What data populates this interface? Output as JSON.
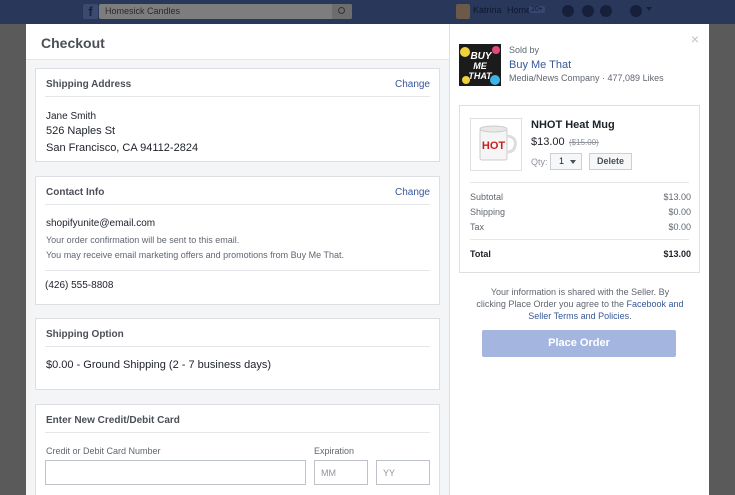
{
  "topbar": {
    "search_value": "Homesick Candles",
    "user_name": "Katrina",
    "home_label": "Home",
    "home_count": "20+"
  },
  "checkout": {
    "title": "Checkout",
    "shipping_address": {
      "title": "Shipping Address",
      "change_label": "Change",
      "name": "Jane Smith",
      "street": "526 Naples St",
      "city_line": "San Francisco, CA 94112-2824"
    },
    "contact_info": {
      "title": "Contact Info",
      "change_label": "Change",
      "email": "shopifyunite@email.com",
      "note_line1": "Your order confirmation will be sent to this email.",
      "note_line2": "You may receive email marketing offers and promotions from Buy Me That.",
      "phone": "(426) 555-8808"
    },
    "shipping_option": {
      "title": "Shipping Option",
      "value": "$0.00 - Ground Shipping (2 - 7 business days)"
    },
    "card": {
      "title": "Enter New Credit/Debit Card",
      "number_label": "Credit or Debit Card Number",
      "expiration_label": "Expiration",
      "mm_placeholder": "MM",
      "yy_placeholder": "YY"
    }
  },
  "seller": {
    "sold_by_label": "Sold by",
    "name": "Buy Me That",
    "meta": "Media/News Company · 477,089 Likes",
    "logo_text_1": "BUY",
    "logo_text_2": "ME",
    "logo_text_3": "THAT"
  },
  "order": {
    "product_name": "NHOT Heat Mug",
    "price": "$13.00",
    "original_price": "($15.00)",
    "mug_text": "HOT",
    "qty_label": "Qty:",
    "qty_value": "1",
    "delete_label": "Delete",
    "subtotal_label": "Subtotal",
    "subtotal_value": "$13.00",
    "shipping_label": "Shipping",
    "shipping_value": "$0.00",
    "tax_label": "Tax",
    "tax_value": "$0.00",
    "total_label": "Total",
    "total_value": "$13.00"
  },
  "legal": {
    "line1": "Your information is shared with the Seller. By",
    "line2_prefix": "clicking Place Order you agree to the",
    "line2_link": "Facebook and",
    "line3_link": "Seller Terms and Policies",
    "line3_suffix": "."
  },
  "place_order_label": "Place Order",
  "close_symbol": "×",
  "colors": {
    "link": "#365899",
    "place_order_button": "#a4b6e0",
    "facebook_bar": "#29375a"
  }
}
